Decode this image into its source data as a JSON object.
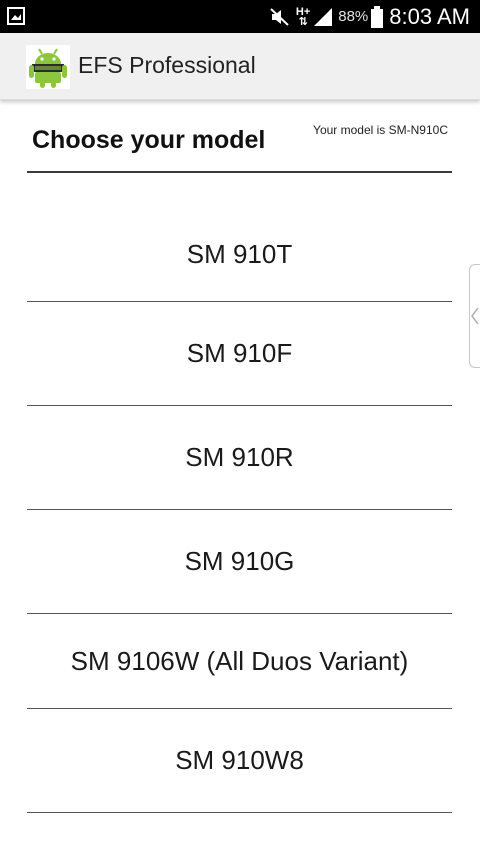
{
  "status_bar": {
    "network": "H+",
    "battery_percent": "88%",
    "time": "8:03 AM",
    "icons": [
      "gallery-notification-icon",
      "mute-icon",
      "signal-icon",
      "battery-icon"
    ]
  },
  "action_bar": {
    "title": "EFS Professional",
    "icon": "android-app-icon"
  },
  "content": {
    "heading": "Choose your model",
    "model_note": "Your model is SM-N910C",
    "models": [
      "SM 910T",
      "SM 910F",
      "SM 910R",
      "SM 910G",
      "SM 9106W (All Duos Variant)",
      "SM 910W8"
    ]
  },
  "colors": {
    "status_bar_bg": "#000000",
    "action_bar_bg": "#f0f0f0",
    "android_green": "#8cc63f"
  }
}
